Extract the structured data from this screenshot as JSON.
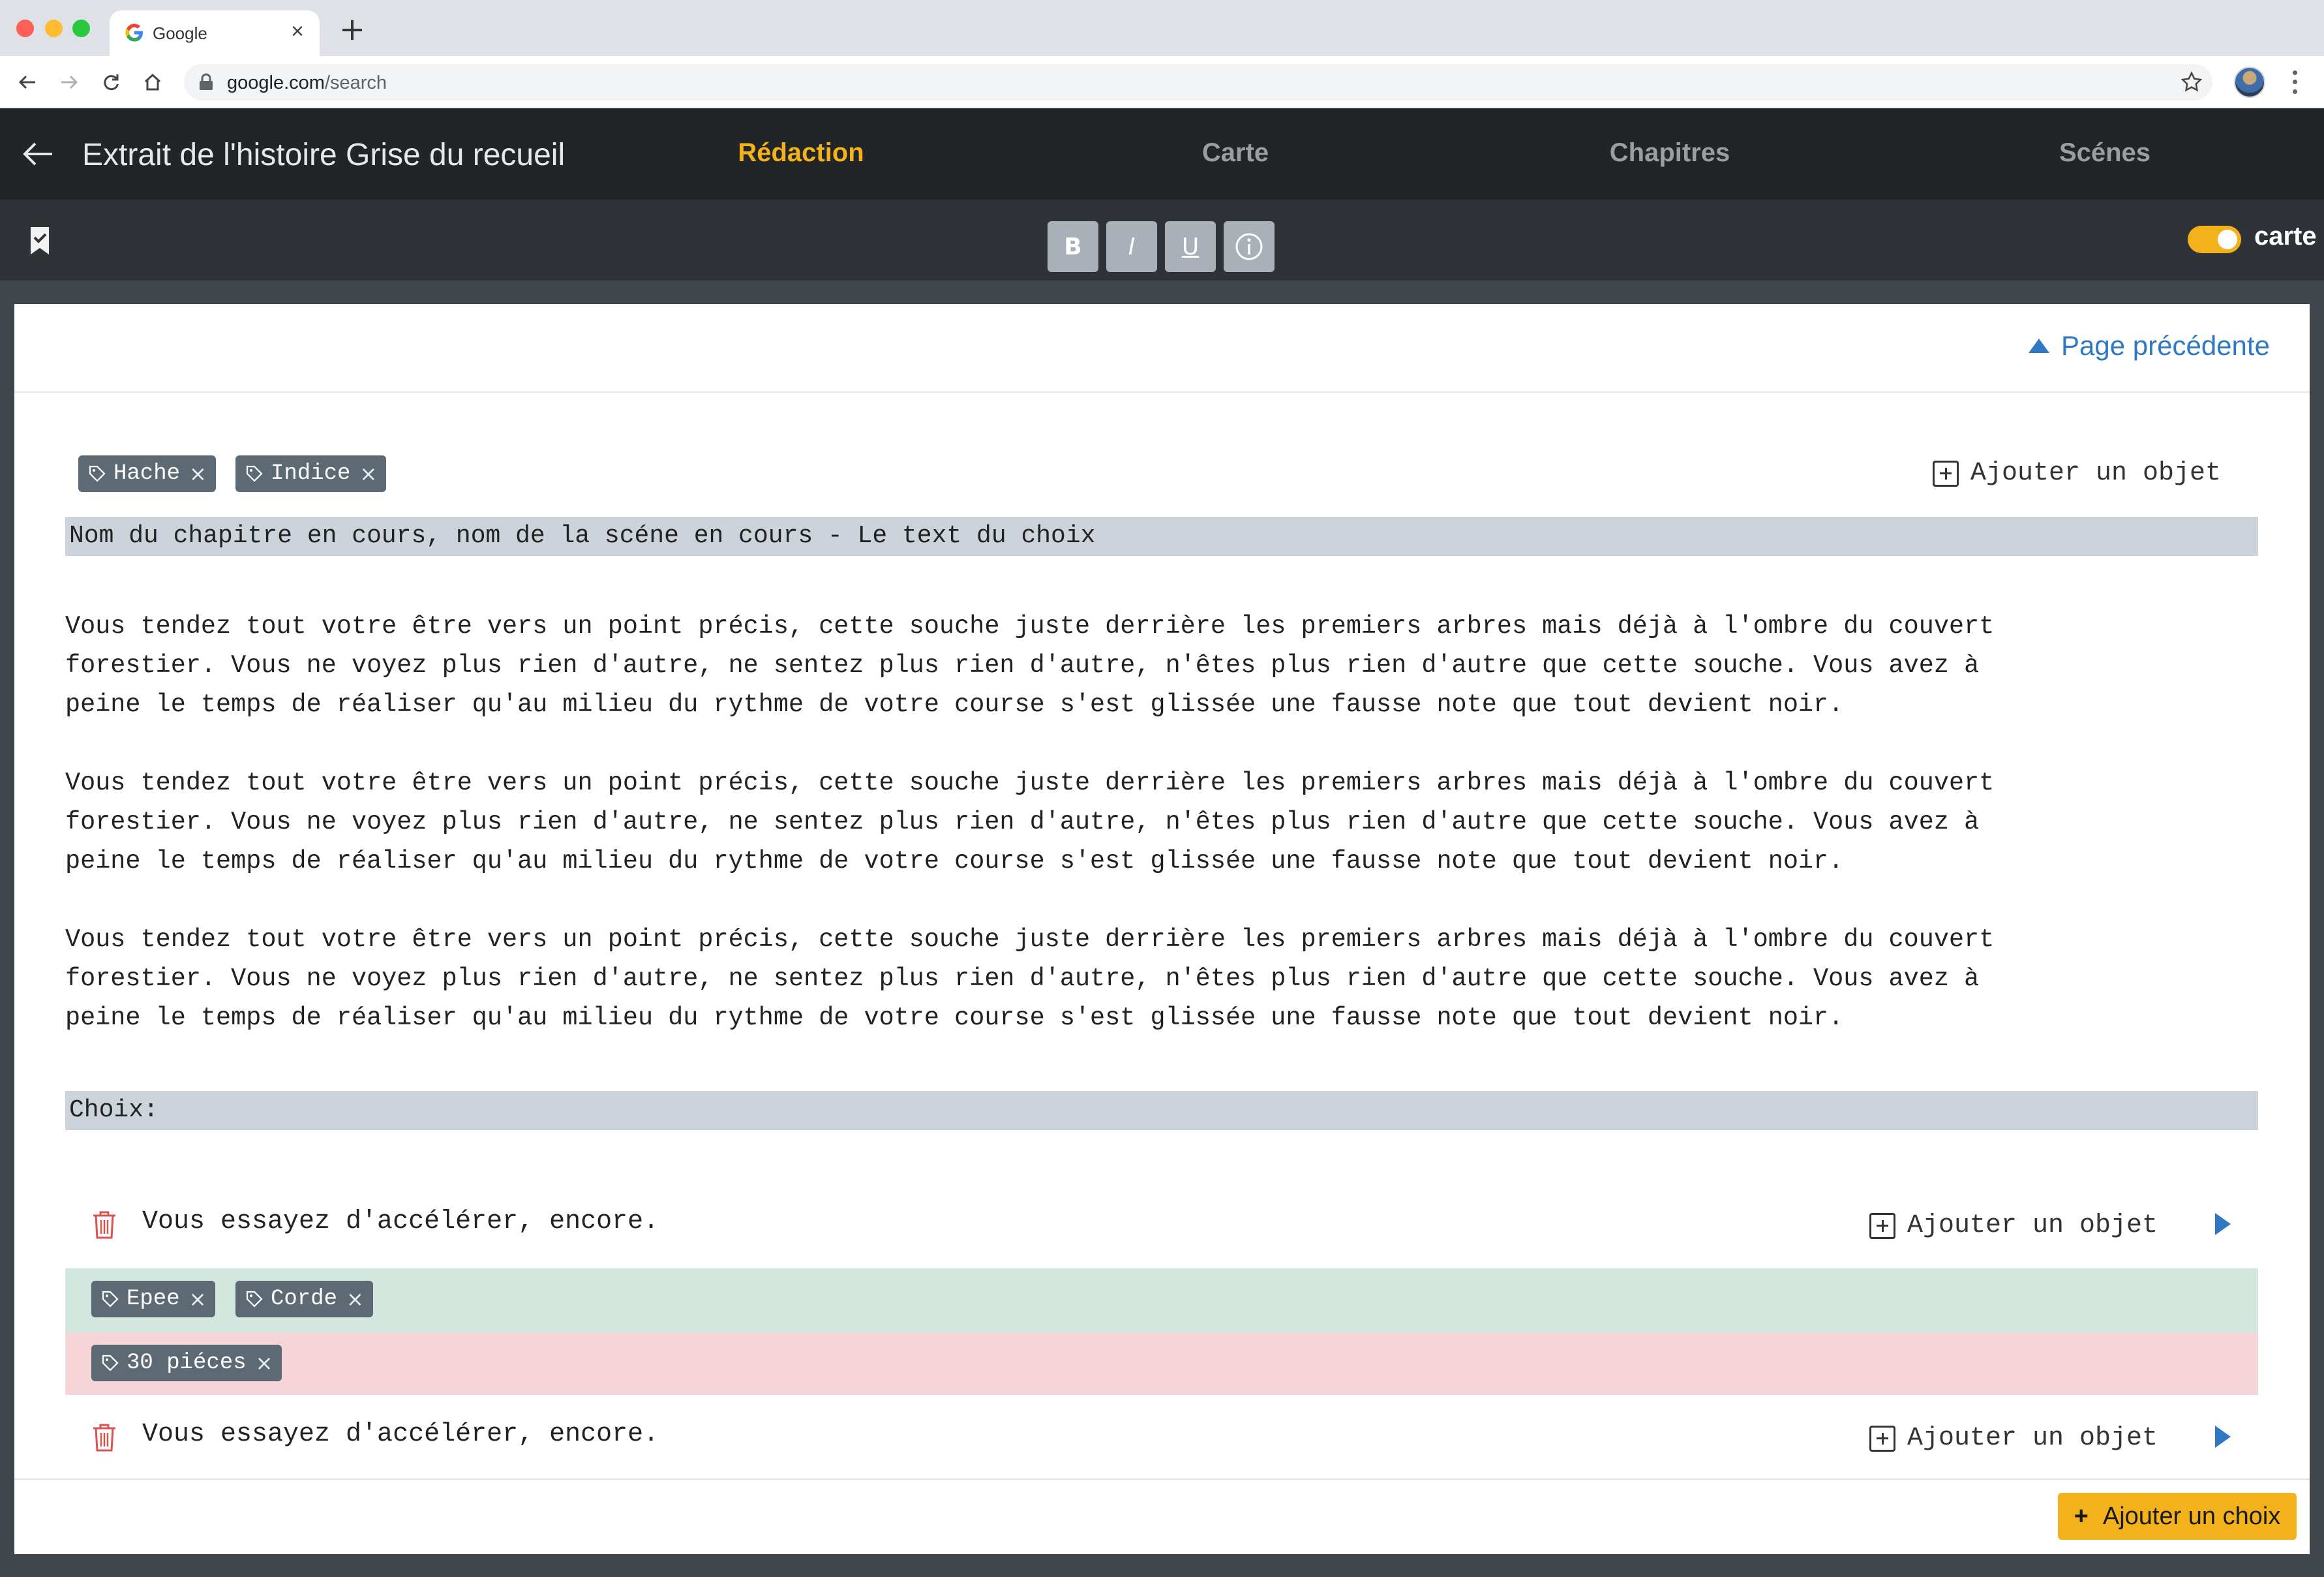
{
  "browser": {
    "tab_title": "Google",
    "url_domain": "google.com",
    "url_path": "/search",
    "new_tab_symbol": "+",
    "tab_close_symbol": "×"
  },
  "header": {
    "title": "Extrait de l'histoire Grise du recueil",
    "tabs": [
      {
        "label": "Rédaction",
        "active": true
      },
      {
        "label": "Carte",
        "active": false
      },
      {
        "label": "Chapitres",
        "active": false
      },
      {
        "label": "Scénes",
        "active": false
      }
    ]
  },
  "toolbar": {
    "buttons": [
      {
        "label": "B",
        "icon": "bold-icon"
      },
      {
        "label": "I",
        "icon": "italic-icon"
      },
      {
        "label": "U",
        "icon": "underline-icon"
      },
      {
        "label": "i",
        "icon": "info-icon"
      }
    ],
    "toggle_label": "carte",
    "toggle_on": true
  },
  "page": {
    "prev_page_label": "Page précédente",
    "tags": [
      "Hache",
      "Indice"
    ],
    "add_object_label": "Ajouter un objet",
    "section_heading": "Nom du chapitre en cours, nom de la scéne en cours - Le text du choix",
    "paragraphs": [
      "Vous tendez tout votre être vers un point précis, cette souche juste derrière les premiers arbres mais déjà à l'ombre du couvert\nforestier. Vous ne voyez plus rien d'autre, ne sentez plus rien d'autre, n'êtes plus rien d'autre que cette souche. Vous avez à\npeine le temps de réaliser qu'au milieu du rythme de votre course s'est glissée une fausse note que tout devient noir.",
      "Vous tendez tout votre être vers un point précis, cette souche juste derrière les premiers arbres mais déjà à l'ombre du couvert\nforestier. Vous ne voyez plus rien d'autre, ne sentez plus rien d'autre, n'êtes plus rien d'autre que cette souche. Vous avez à\npeine le temps de réaliser qu'au milieu du rythme de votre course s'est glissée une fausse note que tout devient noir.",
      "Vous tendez tout votre être vers un point précis, cette souche juste derrière les premiers arbres mais déjà à l'ombre du couvert\nforestier. Vous ne voyez plus rien d'autre, ne sentez plus rien d'autre, n'êtes plus rien d'autre que cette souche. Vous avez à\npeine le temps de réaliser qu'au milieu du rythme de votre course s'est glissée une fausse note que tout devient noir."
    ],
    "choices_heading": "Choix:",
    "choices": [
      {
        "text": "Vous essayez d'accélérer, encore.",
        "add_object_label": "Ajouter un objet",
        "gain_tags": [
          "Epee",
          "Corde"
        ],
        "loss_tags": [
          "30 piéces"
        ]
      },
      {
        "text": "Vous essayez d'accélérer, encore.",
        "add_object_label": "Ajouter un objet",
        "gain_tags": [],
        "loss_tags": []
      }
    ],
    "add_choice_label": "Ajouter un choix",
    "add_choice_symbol": "+",
    "tag_remove_symbol": "×"
  },
  "colors": {
    "accent": "#f3b21b",
    "link": "#2f78c4",
    "header_bg": "#222528",
    "toolbar_bg": "#2f3338",
    "tag_bg": "#5d6a74",
    "gain_bg": "#d2e7dd",
    "loss_bg": "#f6d5d8",
    "delete": "#d9534f"
  }
}
